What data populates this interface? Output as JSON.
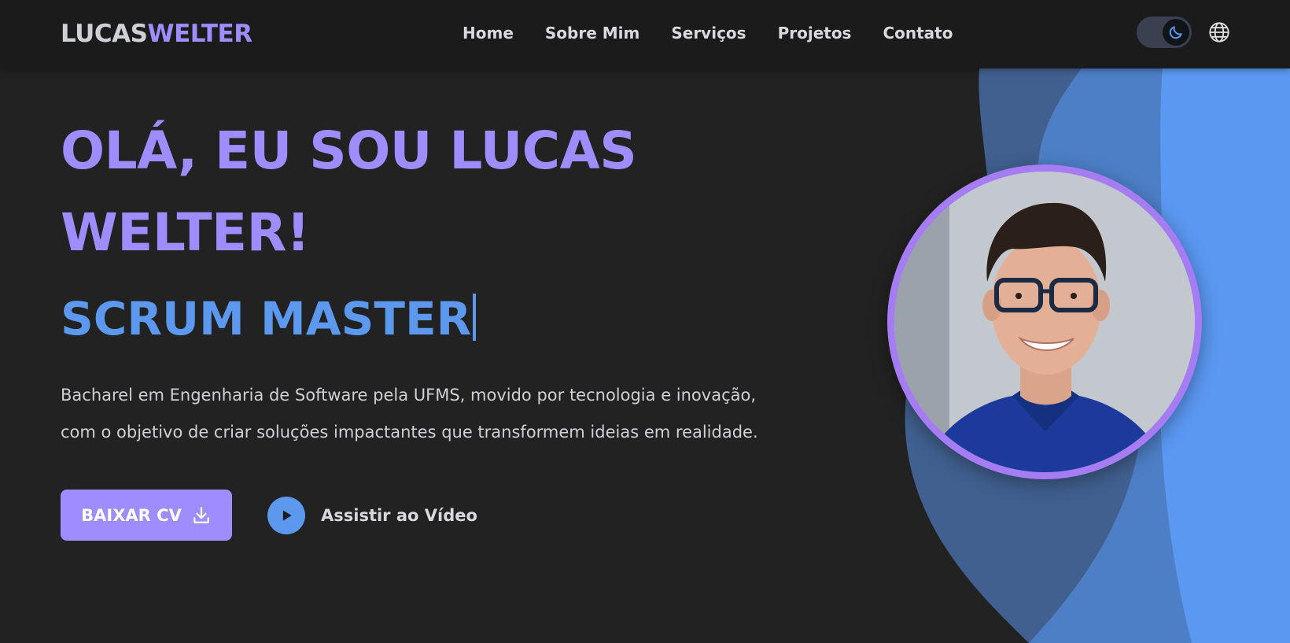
{
  "brand": {
    "first": "LUCAS",
    "second": "WELTER"
  },
  "nav": {
    "items": [
      {
        "label": "Home"
      },
      {
        "label": "Sobre Mim"
      },
      {
        "label": "Serviços"
      },
      {
        "label": "Projetos"
      },
      {
        "label": "Contato"
      }
    ],
    "theme_toggle_icon": "moon-icon",
    "language_icon": "globe-icon"
  },
  "hero": {
    "title": "OLÁ, EU SOU LUCAS WELTER!",
    "role": "SCRUM MASTER",
    "description": "Bacharel em Engenharia de Software pela UFMS, movido por tecnologia e inovação, com o objetivo de criar soluções impactantes que transformem ideias em realidade.",
    "cv_button": "BAIXAR CV",
    "video_button": "Assistir ao Vídeo"
  },
  "colors": {
    "accent_purple": "#9f8cff",
    "accent_blue": "#5b98ee",
    "background": "#222222",
    "navbar": "#1b1b1b"
  }
}
